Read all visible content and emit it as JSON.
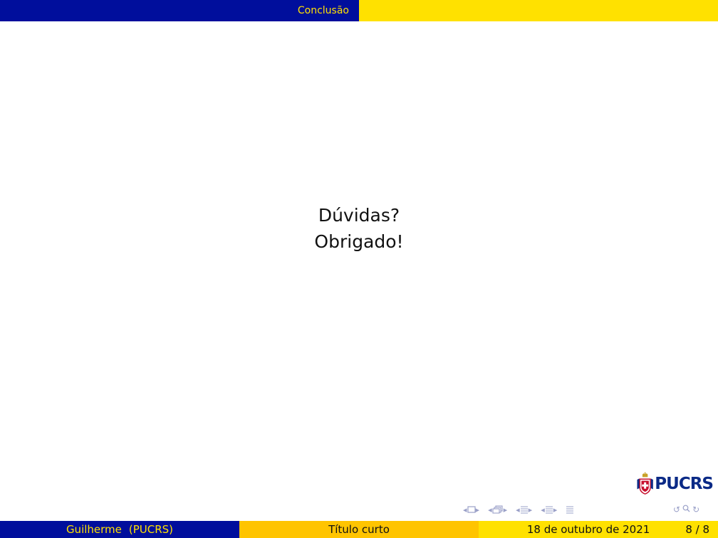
{
  "header": {
    "section": "Conclusão"
  },
  "main": {
    "line1": "Dúvidas?",
    "line2": "Obrigado!"
  },
  "logo": {
    "text": "PUCRS"
  },
  "footer": {
    "author": "Guilherme",
    "institution": "(PUCRS)",
    "title": "Título curto",
    "date": "18 de outubro de 2021",
    "page": "8 / 8"
  },
  "colors": {
    "blue": "#000e9c",
    "yellow": "#ffe100",
    "orange": "#ffc400"
  }
}
